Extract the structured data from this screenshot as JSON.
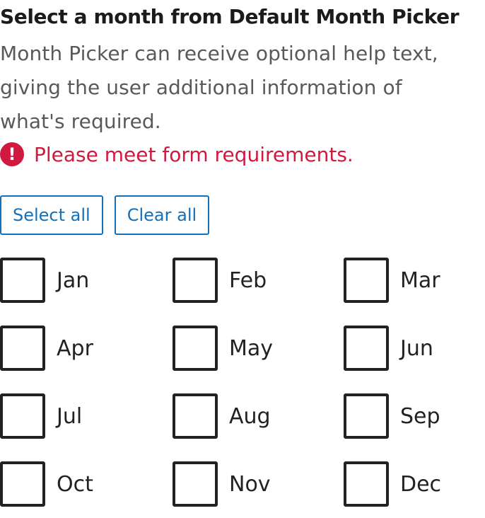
{
  "title": "Select a month from Default Month Picker",
  "help_text_lines": [
    "Month Picker can receive optional help text,",
    "giving the user additional information of",
    "what's required."
  ],
  "error": {
    "icon_glyph": "!",
    "icon_name": "error-icon",
    "message": "Please meet form requirements."
  },
  "buttons": {
    "select_all": "Select all",
    "clear_all": "Clear all"
  },
  "months": [
    {
      "label": "Jan",
      "checked": false
    },
    {
      "label": "Feb",
      "checked": false
    },
    {
      "label": "Mar",
      "checked": false
    },
    {
      "label": "Apr",
      "checked": false
    },
    {
      "label": "May",
      "checked": false
    },
    {
      "label": "Jun",
      "checked": false
    },
    {
      "label": "Jul",
      "checked": false
    },
    {
      "label": "Aug",
      "checked": false
    },
    {
      "label": "Sep",
      "checked": false
    },
    {
      "label": "Oct",
      "checked": false
    },
    {
      "label": "Nov",
      "checked": false
    },
    {
      "label": "Dec",
      "checked": false
    }
  ],
  "colors": {
    "accent": "#1470b8",
    "error": "#d0193f",
    "text": "#222222",
    "help_text": "#595959"
  }
}
